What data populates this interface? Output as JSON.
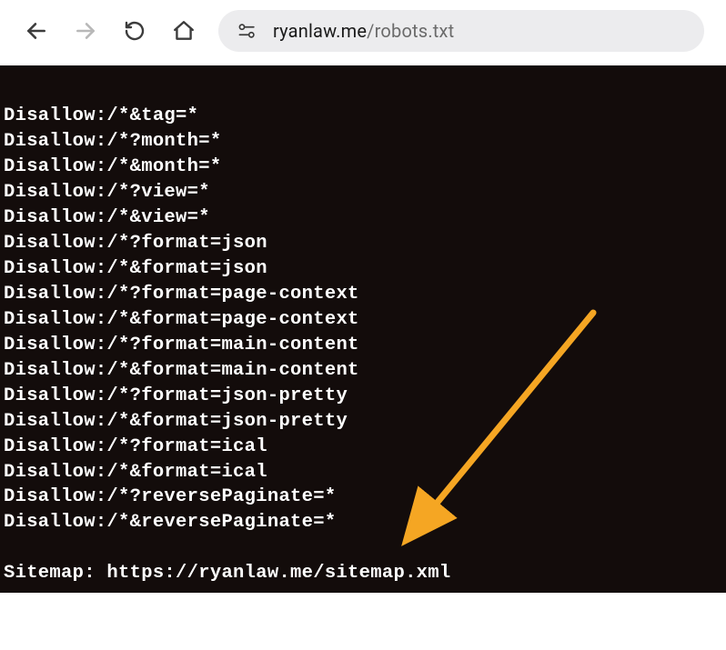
{
  "toolbar": {
    "url_host": "ryanlaw.me",
    "url_path": "/robots.txt"
  },
  "robots": {
    "partial_top_line": "Disallow:/*&tag=*",
    "disallow_lines": [
      "Disallow:/*?month=*",
      "Disallow:/*&month=*",
      "Disallow:/*?view=*",
      "Disallow:/*&view=*",
      "Disallow:/*?format=json",
      "Disallow:/*&format=json",
      "Disallow:/*?format=page-context",
      "Disallow:/*&format=page-context",
      "Disallow:/*?format=main-content",
      "Disallow:/*&format=main-content",
      "Disallow:/*?format=json-pretty",
      "Disallow:/*&format=json-pretty",
      "Disallow:/*?format=ical",
      "Disallow:/*&format=ical",
      "Disallow:/*?reversePaginate=*",
      "Disallow:/*&reversePaginate=*"
    ],
    "sitemap_line": "Sitemap: https://ryanlaw.me/sitemap.xml"
  },
  "annotation": {
    "arrow_color": "#f5a623"
  }
}
